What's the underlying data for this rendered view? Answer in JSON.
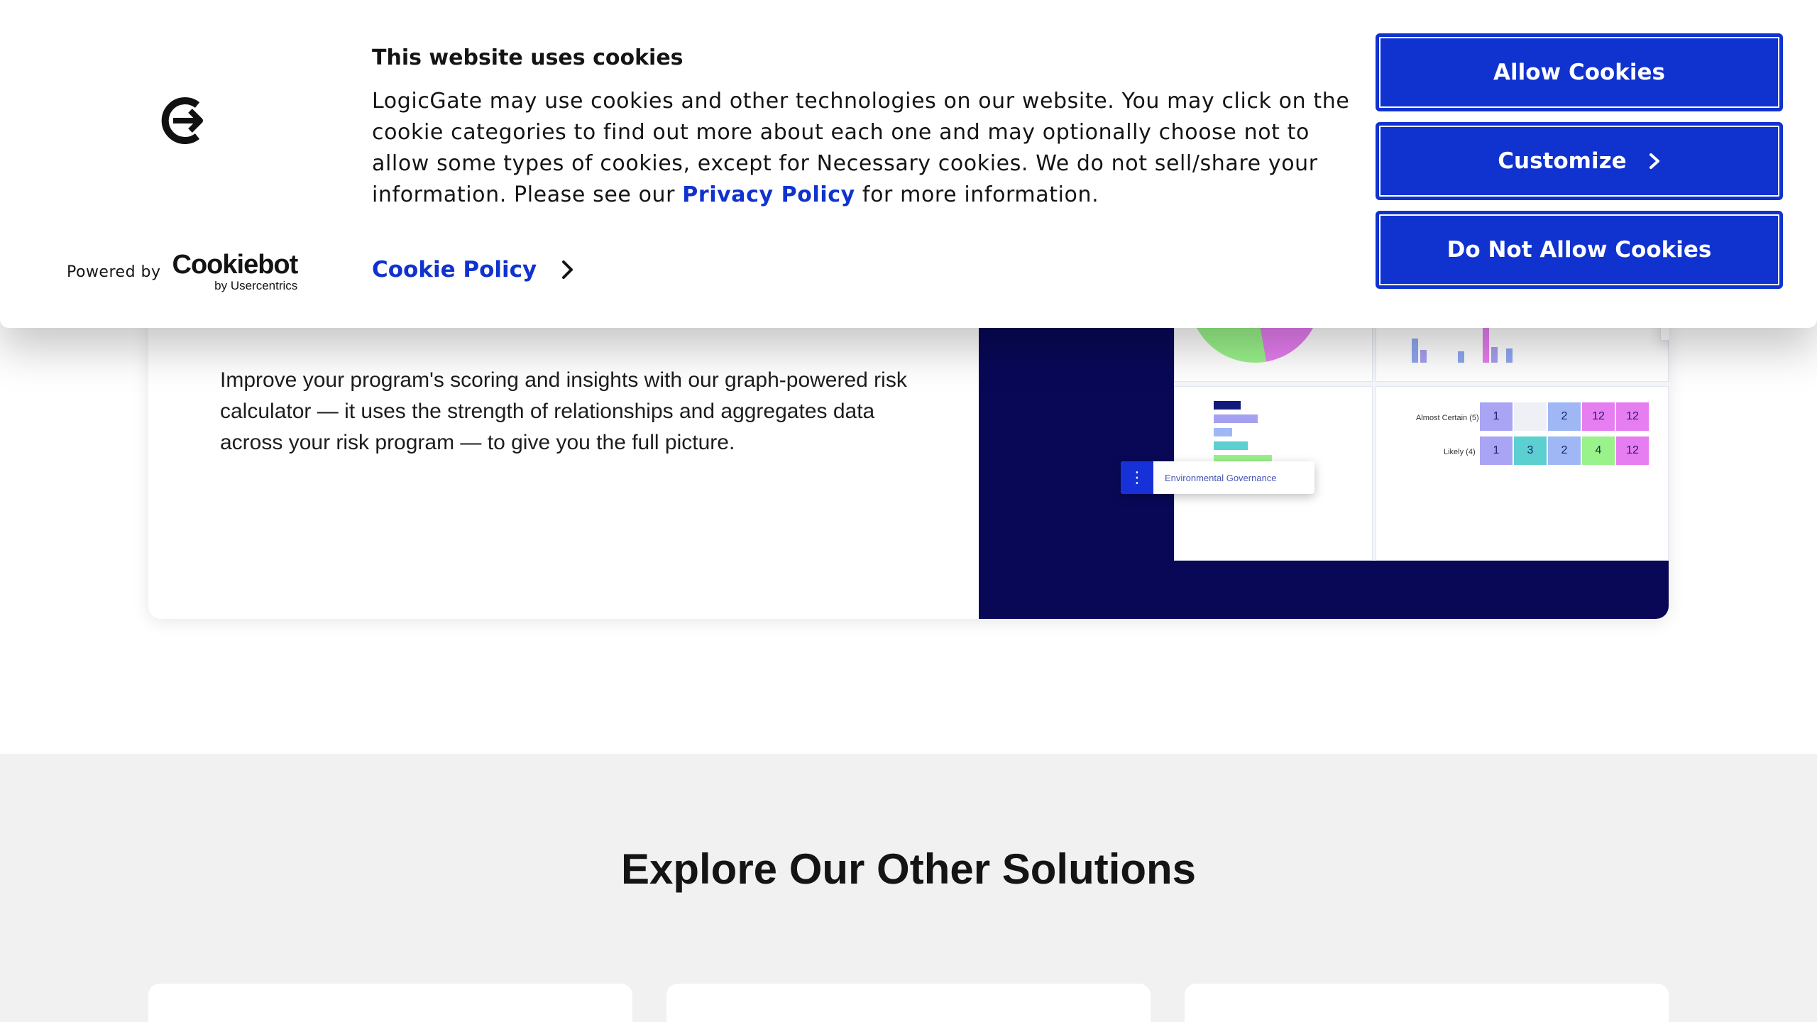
{
  "cookie_banner": {
    "title": "This website uses cookies",
    "body_before_link": "LogicGate may use cookies and other technologies on our website. You may click on the cookie categories to find out more about each one and may optionally choose not to allow some types of cookies, except for Necessary cookies.  We do not sell/share your information. Please see our ",
    "privacy_link": "Privacy Policy",
    "body_after_link": " for more information.",
    "cookie_policy_link": "Cookie Policy",
    "powered_by": "Powered by",
    "brand_name": "Cookiebot",
    "brand_sub": "by Usercentrics",
    "buttons": {
      "allow": "Allow Cookies",
      "customize": "Customize",
      "deny": "Do Not Allow Cookies"
    },
    "accent_color": "#1032cf"
  },
  "feature": {
    "body": "Improve your program's scoring and insights with our graph-powered risk calculator — it uses the strength of relationships and aggregates data across your risk program — to give you the full picture.",
    "chip_label": "Environmental Governance",
    "heatmap": {
      "rows": [
        {
          "label": "Almost Certain (5)",
          "cells": [
            "1",
            "",
            "2",
            "12",
            "12"
          ]
        },
        {
          "label": "Likely (4)",
          "cells": [
            "1",
            "3",
            "2",
            "4",
            "12"
          ]
        }
      ]
    }
  },
  "solutions": {
    "title": "Explore Our Other Solutions"
  }
}
